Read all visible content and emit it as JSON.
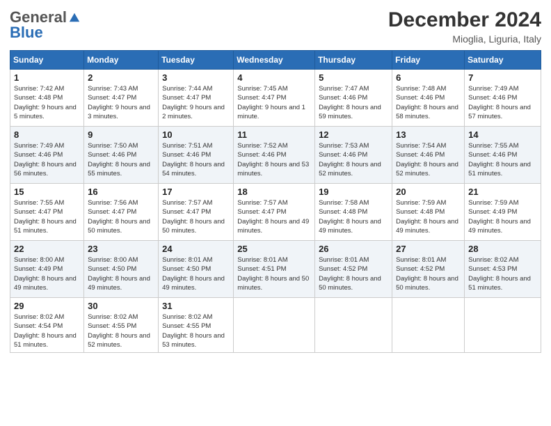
{
  "header": {
    "logo_general": "General",
    "logo_blue": "Blue",
    "month_title": "December 2024",
    "location": "Mioglia, Liguria, Italy"
  },
  "weekdays": [
    "Sunday",
    "Monday",
    "Tuesday",
    "Wednesday",
    "Thursday",
    "Friday",
    "Saturday"
  ],
  "weeks": [
    [
      {
        "day": "1",
        "sunrise": "7:42 AM",
        "sunset": "4:48 PM",
        "daylight": "9 hours and 5 minutes."
      },
      {
        "day": "2",
        "sunrise": "7:43 AM",
        "sunset": "4:47 PM",
        "daylight": "9 hours and 3 minutes."
      },
      {
        "day": "3",
        "sunrise": "7:44 AM",
        "sunset": "4:47 PM",
        "daylight": "9 hours and 2 minutes."
      },
      {
        "day": "4",
        "sunrise": "7:45 AM",
        "sunset": "4:47 PM",
        "daylight": "9 hours and 1 minute."
      },
      {
        "day": "5",
        "sunrise": "7:47 AM",
        "sunset": "4:46 PM",
        "daylight": "8 hours and 59 minutes."
      },
      {
        "day": "6",
        "sunrise": "7:48 AM",
        "sunset": "4:46 PM",
        "daylight": "8 hours and 58 minutes."
      },
      {
        "day": "7",
        "sunrise": "7:49 AM",
        "sunset": "4:46 PM",
        "daylight": "8 hours and 57 minutes."
      }
    ],
    [
      {
        "day": "8",
        "sunrise": "7:49 AM",
        "sunset": "4:46 PM",
        "daylight": "8 hours and 56 minutes."
      },
      {
        "day": "9",
        "sunrise": "7:50 AM",
        "sunset": "4:46 PM",
        "daylight": "8 hours and 55 minutes."
      },
      {
        "day": "10",
        "sunrise": "7:51 AM",
        "sunset": "4:46 PM",
        "daylight": "8 hours and 54 minutes."
      },
      {
        "day": "11",
        "sunrise": "7:52 AM",
        "sunset": "4:46 PM",
        "daylight": "8 hours and 53 minutes."
      },
      {
        "day": "12",
        "sunrise": "7:53 AM",
        "sunset": "4:46 PM",
        "daylight": "8 hours and 52 minutes."
      },
      {
        "day": "13",
        "sunrise": "7:54 AM",
        "sunset": "4:46 PM",
        "daylight": "8 hours and 52 minutes."
      },
      {
        "day": "14",
        "sunrise": "7:55 AM",
        "sunset": "4:46 PM",
        "daylight": "8 hours and 51 minutes."
      }
    ],
    [
      {
        "day": "15",
        "sunrise": "7:55 AM",
        "sunset": "4:47 PM",
        "daylight": "8 hours and 51 minutes."
      },
      {
        "day": "16",
        "sunrise": "7:56 AM",
        "sunset": "4:47 PM",
        "daylight": "8 hours and 50 minutes."
      },
      {
        "day": "17",
        "sunrise": "7:57 AM",
        "sunset": "4:47 PM",
        "daylight": "8 hours and 50 minutes."
      },
      {
        "day": "18",
        "sunrise": "7:57 AM",
        "sunset": "4:47 PM",
        "daylight": "8 hours and 49 minutes."
      },
      {
        "day": "19",
        "sunrise": "7:58 AM",
        "sunset": "4:48 PM",
        "daylight": "8 hours and 49 minutes."
      },
      {
        "day": "20",
        "sunrise": "7:59 AM",
        "sunset": "4:48 PM",
        "daylight": "8 hours and 49 minutes."
      },
      {
        "day": "21",
        "sunrise": "7:59 AM",
        "sunset": "4:49 PM",
        "daylight": "8 hours and 49 minutes."
      }
    ],
    [
      {
        "day": "22",
        "sunrise": "8:00 AM",
        "sunset": "4:49 PM",
        "daylight": "8 hours and 49 minutes."
      },
      {
        "day": "23",
        "sunrise": "8:00 AM",
        "sunset": "4:50 PM",
        "daylight": "8 hours and 49 minutes."
      },
      {
        "day": "24",
        "sunrise": "8:01 AM",
        "sunset": "4:50 PM",
        "daylight": "8 hours and 49 minutes."
      },
      {
        "day": "25",
        "sunrise": "8:01 AM",
        "sunset": "4:51 PM",
        "daylight": "8 hours and 50 minutes."
      },
      {
        "day": "26",
        "sunrise": "8:01 AM",
        "sunset": "4:52 PM",
        "daylight": "8 hours and 50 minutes."
      },
      {
        "day": "27",
        "sunrise": "8:01 AM",
        "sunset": "4:52 PM",
        "daylight": "8 hours and 50 minutes."
      },
      {
        "day": "28",
        "sunrise": "8:02 AM",
        "sunset": "4:53 PM",
        "daylight": "8 hours and 51 minutes."
      }
    ],
    [
      {
        "day": "29",
        "sunrise": "8:02 AM",
        "sunset": "4:54 PM",
        "daylight": "8 hours and 51 minutes."
      },
      {
        "day": "30",
        "sunrise": "8:02 AM",
        "sunset": "4:55 PM",
        "daylight": "8 hours and 52 minutes."
      },
      {
        "day": "31",
        "sunrise": "8:02 AM",
        "sunset": "4:55 PM",
        "daylight": "8 hours and 53 minutes."
      },
      null,
      null,
      null,
      null
    ]
  ]
}
